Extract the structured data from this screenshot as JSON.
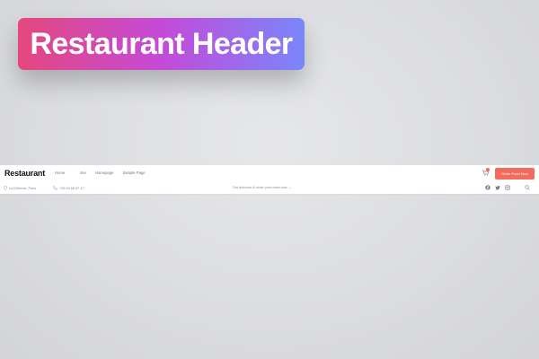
{
  "badge": {
    "title": "Restaurant Header"
  },
  "header": {
    "logo": "Restaurant",
    "nav": [
      {
        "label": "Home"
      },
      {
        "label": "dev"
      },
      {
        "label": "Homepage"
      },
      {
        "label": "Sample Page"
      }
    ],
    "order_button": "Order Food Now",
    "address": "La Défense, Paris",
    "phone": "+33 64 68 87 47",
    "promo": "Get discount & order your meal now →",
    "icons": {
      "cart": "cart-icon",
      "location": "location-pin-icon",
      "phone": "phone-icon",
      "facebook": "facebook-icon",
      "twitter": "twitter-icon",
      "instagram": "instagram-icon",
      "search": "search-icon"
    },
    "colors": {
      "accent": "#f26c5e",
      "gradient_start": "#e5487e",
      "gradient_mid": "#c44ad8",
      "gradient_end": "#7a86fb"
    }
  }
}
